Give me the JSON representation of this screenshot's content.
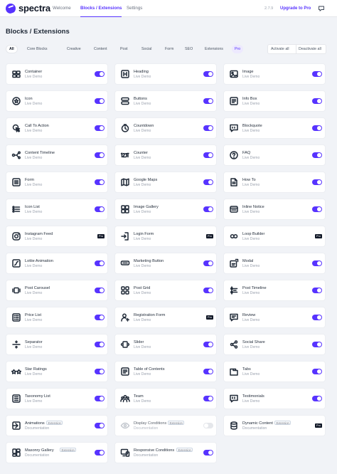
{
  "header": {
    "brand": "spectra",
    "nav": [
      {
        "label": "Welcome",
        "active": false
      },
      {
        "label": "Blocks / Extensions",
        "active": true
      },
      {
        "label": "Settings",
        "active": false
      }
    ],
    "version": "2.7.9",
    "upgrade_label": "Upgrade to Pro"
  },
  "page_title": "Blocks / Extensions",
  "filters": [
    "All",
    "Core Blocks",
    "Creative",
    "Content",
    "Post",
    "Social",
    "Form",
    "SEO",
    "Extensions",
    "Pro"
  ],
  "bulk": {
    "activate": "Activate all",
    "deactivate": "Deactivate all"
  },
  "accent_color": "#5733ff",
  "badges": {
    "pro": "Pro",
    "extension": "Extension"
  },
  "blocks": [
    {
      "name": "Container",
      "sub": "Live Demo",
      "icon": "container-icon",
      "state": "on"
    },
    {
      "name": "Heading",
      "sub": "Live Demo",
      "icon": "heading-icon",
      "state": "on"
    },
    {
      "name": "Image",
      "sub": "Live Demo",
      "icon": "image-icon",
      "state": "on"
    },
    {
      "name": "Icon",
      "sub": "Live Demo",
      "icon": "star-icon",
      "state": "on"
    },
    {
      "name": "Buttons",
      "sub": "Live Demo",
      "icon": "buttons-icon",
      "state": "on"
    },
    {
      "name": "Info Box",
      "sub": "Live Demo",
      "icon": "info-box-icon",
      "state": "on"
    },
    {
      "name": "Call To Action",
      "sub": "Live Demo",
      "icon": "cursor-click-icon",
      "state": "on"
    },
    {
      "name": "Countdown",
      "sub": "Live Demo",
      "icon": "clock-icon",
      "state": "on"
    },
    {
      "name": "Blockquote",
      "sub": "Live Demo",
      "icon": "quote-icon",
      "state": "on"
    },
    {
      "name": "Content Timeline",
      "sub": "Live Demo",
      "icon": "timeline-icon",
      "state": "on"
    },
    {
      "name": "Counter",
      "sub": "Live Demo",
      "icon": "counter-icon",
      "state": "on"
    },
    {
      "name": "FAQ",
      "sub": "Live Demo",
      "icon": "faq-icon",
      "state": "on"
    },
    {
      "name": "Form",
      "sub": "Live Demo",
      "icon": "form-icon",
      "state": "on"
    },
    {
      "name": "Google Maps",
      "sub": "Live Demo",
      "icon": "map-icon",
      "state": "on"
    },
    {
      "name": "How To",
      "sub": "Live Demo",
      "icon": "document-icon",
      "state": "on"
    },
    {
      "name": "Icon List",
      "sub": "Live Demo",
      "icon": "list-icon",
      "state": "on"
    },
    {
      "name": "Image Gallery",
      "sub": "Live Demo",
      "icon": "gallery-icon",
      "state": "on"
    },
    {
      "name": "Inline Notice",
      "sub": "Live Demo",
      "icon": "notice-icon",
      "state": "on"
    },
    {
      "name": "Instagram Feed",
      "sub": "Live Demo",
      "icon": "instagram-icon",
      "state": "pro"
    },
    {
      "name": "Login Form",
      "sub": "Live Demo",
      "icon": "login-icon",
      "state": "pro"
    },
    {
      "name": "Loop Builder",
      "sub": "Live Demo",
      "icon": "loop-icon",
      "state": "pro"
    },
    {
      "name": "Lottie Animation",
      "sub": "Live Demo",
      "icon": "lottie-icon",
      "state": "on"
    },
    {
      "name": "Marketing Button",
      "sub": "Live Demo",
      "icon": "marketing-button-icon",
      "state": "on"
    },
    {
      "name": "Modal",
      "sub": "Live Demo",
      "icon": "modal-icon",
      "state": "on"
    },
    {
      "name": "Post Carousel",
      "sub": "Live Demo",
      "icon": "carousel-icon",
      "state": "on"
    },
    {
      "name": "Post Grid",
      "sub": "Live Demo",
      "icon": "grid-icon",
      "state": "on"
    },
    {
      "name": "Post Timeline",
      "sub": "Live Demo",
      "icon": "post-timeline-icon",
      "state": "on"
    },
    {
      "name": "Price List",
      "sub": "Live Demo",
      "icon": "price-list-icon",
      "state": "on"
    },
    {
      "name": "Registration Form",
      "sub": "Live Demo",
      "icon": "user-add-icon",
      "state": "pro"
    },
    {
      "name": "Review",
      "sub": "Live Demo",
      "icon": "review-icon",
      "state": "on"
    },
    {
      "name": "Separator",
      "sub": "Live Demo",
      "icon": "separator-icon",
      "state": "on"
    },
    {
      "name": "Slider",
      "sub": "Live Demo",
      "icon": "slider-icon",
      "state": "on"
    },
    {
      "name": "Social Share",
      "sub": "Live Demo",
      "icon": "share-icon",
      "state": "on"
    },
    {
      "name": "Star Ratings",
      "sub": "Live Demo",
      "icon": "star-ratings-icon",
      "state": "on"
    },
    {
      "name": "Table of Contents",
      "sub": "Live Demo",
      "icon": "table-of-contents-icon",
      "state": "on"
    },
    {
      "name": "Tabs",
      "sub": "Live Demo",
      "icon": "tabs-icon",
      "state": "on"
    },
    {
      "name": "Taxonomy List",
      "sub": "Live Demo",
      "icon": "taxonomy-icon",
      "state": "on"
    },
    {
      "name": "Team",
      "sub": "Live Demo",
      "icon": "team-icon",
      "state": "on"
    },
    {
      "name": "Testimonials",
      "sub": "Live Demo",
      "icon": "testimonials-icon",
      "state": "on"
    },
    {
      "name": "Animations",
      "sub": "Documentation",
      "icon": "animations-icon",
      "state": "on",
      "tag": "Extension"
    },
    {
      "name": "Display Conditions",
      "sub": "Documentation",
      "icon": "eye-icon",
      "state": "off",
      "tag": "Extension"
    },
    {
      "name": "Dynamic Content",
      "sub": "Documentation",
      "icon": "database-icon",
      "state": "pro",
      "tag": "Extension"
    },
    {
      "name": "Masonry Gallery",
      "sub": "Documentation",
      "icon": "masonry-icon",
      "state": "on",
      "tag": "Extension"
    },
    {
      "name": "Responsive Conditions",
      "sub": "Documentation",
      "icon": "responsive-icon",
      "state": "on",
      "tag": "Extension"
    }
  ]
}
